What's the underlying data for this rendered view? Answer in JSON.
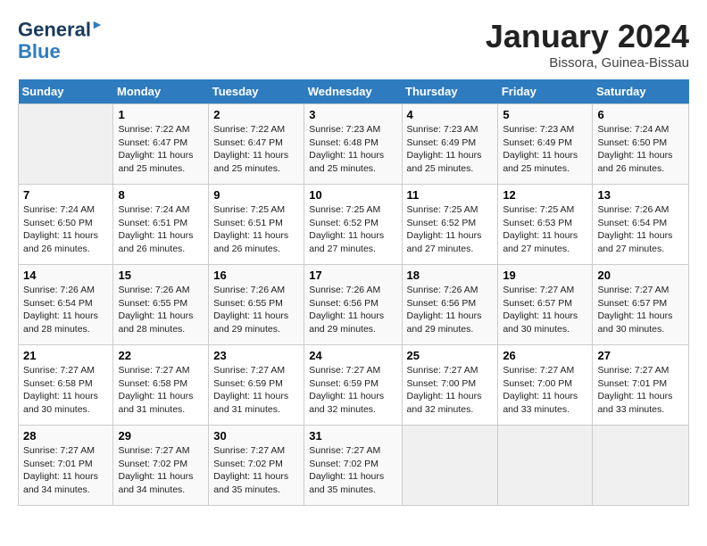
{
  "header": {
    "logo_line1": "General",
    "logo_line2": "Blue",
    "month": "January 2024",
    "location": "Bissora, Guinea-Bissau"
  },
  "weekdays": [
    "Sunday",
    "Monday",
    "Tuesday",
    "Wednesday",
    "Thursday",
    "Friday",
    "Saturday"
  ],
  "weeks": [
    [
      {
        "day": "",
        "info": ""
      },
      {
        "day": "1",
        "info": "Sunrise: 7:22 AM\nSunset: 6:47 PM\nDaylight: 11 hours\nand 25 minutes."
      },
      {
        "day": "2",
        "info": "Sunrise: 7:22 AM\nSunset: 6:47 PM\nDaylight: 11 hours\nand 25 minutes."
      },
      {
        "day": "3",
        "info": "Sunrise: 7:23 AM\nSunset: 6:48 PM\nDaylight: 11 hours\nand 25 minutes."
      },
      {
        "day": "4",
        "info": "Sunrise: 7:23 AM\nSunset: 6:49 PM\nDaylight: 11 hours\nand 25 minutes."
      },
      {
        "day": "5",
        "info": "Sunrise: 7:23 AM\nSunset: 6:49 PM\nDaylight: 11 hours\nand 25 minutes."
      },
      {
        "day": "6",
        "info": "Sunrise: 7:24 AM\nSunset: 6:50 PM\nDaylight: 11 hours\nand 26 minutes."
      }
    ],
    [
      {
        "day": "7",
        "info": "Sunrise: 7:24 AM\nSunset: 6:50 PM\nDaylight: 11 hours\nand 26 minutes."
      },
      {
        "day": "8",
        "info": "Sunrise: 7:24 AM\nSunset: 6:51 PM\nDaylight: 11 hours\nand 26 minutes."
      },
      {
        "day": "9",
        "info": "Sunrise: 7:25 AM\nSunset: 6:51 PM\nDaylight: 11 hours\nand 26 minutes."
      },
      {
        "day": "10",
        "info": "Sunrise: 7:25 AM\nSunset: 6:52 PM\nDaylight: 11 hours\nand 27 minutes."
      },
      {
        "day": "11",
        "info": "Sunrise: 7:25 AM\nSunset: 6:52 PM\nDaylight: 11 hours\nand 27 minutes."
      },
      {
        "day": "12",
        "info": "Sunrise: 7:25 AM\nSunset: 6:53 PM\nDaylight: 11 hours\nand 27 minutes."
      },
      {
        "day": "13",
        "info": "Sunrise: 7:26 AM\nSunset: 6:54 PM\nDaylight: 11 hours\nand 27 minutes."
      }
    ],
    [
      {
        "day": "14",
        "info": "Sunrise: 7:26 AM\nSunset: 6:54 PM\nDaylight: 11 hours\nand 28 minutes."
      },
      {
        "day": "15",
        "info": "Sunrise: 7:26 AM\nSunset: 6:55 PM\nDaylight: 11 hours\nand 28 minutes."
      },
      {
        "day": "16",
        "info": "Sunrise: 7:26 AM\nSunset: 6:55 PM\nDaylight: 11 hours\nand 29 minutes."
      },
      {
        "day": "17",
        "info": "Sunrise: 7:26 AM\nSunset: 6:56 PM\nDaylight: 11 hours\nand 29 minutes."
      },
      {
        "day": "18",
        "info": "Sunrise: 7:26 AM\nSunset: 6:56 PM\nDaylight: 11 hours\nand 29 minutes."
      },
      {
        "day": "19",
        "info": "Sunrise: 7:27 AM\nSunset: 6:57 PM\nDaylight: 11 hours\nand 30 minutes."
      },
      {
        "day": "20",
        "info": "Sunrise: 7:27 AM\nSunset: 6:57 PM\nDaylight: 11 hours\nand 30 minutes."
      }
    ],
    [
      {
        "day": "21",
        "info": "Sunrise: 7:27 AM\nSunset: 6:58 PM\nDaylight: 11 hours\nand 30 minutes."
      },
      {
        "day": "22",
        "info": "Sunrise: 7:27 AM\nSunset: 6:58 PM\nDaylight: 11 hours\nand 31 minutes."
      },
      {
        "day": "23",
        "info": "Sunrise: 7:27 AM\nSunset: 6:59 PM\nDaylight: 11 hours\nand 31 minutes."
      },
      {
        "day": "24",
        "info": "Sunrise: 7:27 AM\nSunset: 6:59 PM\nDaylight: 11 hours\nand 32 minutes."
      },
      {
        "day": "25",
        "info": "Sunrise: 7:27 AM\nSunset: 7:00 PM\nDaylight: 11 hours\nand 32 minutes."
      },
      {
        "day": "26",
        "info": "Sunrise: 7:27 AM\nSunset: 7:00 PM\nDaylight: 11 hours\nand 33 minutes."
      },
      {
        "day": "27",
        "info": "Sunrise: 7:27 AM\nSunset: 7:01 PM\nDaylight: 11 hours\nand 33 minutes."
      }
    ],
    [
      {
        "day": "28",
        "info": "Sunrise: 7:27 AM\nSunset: 7:01 PM\nDaylight: 11 hours\nand 34 minutes."
      },
      {
        "day": "29",
        "info": "Sunrise: 7:27 AM\nSunset: 7:02 PM\nDaylight: 11 hours\nand 34 minutes."
      },
      {
        "day": "30",
        "info": "Sunrise: 7:27 AM\nSunset: 7:02 PM\nDaylight: 11 hours\nand 35 minutes."
      },
      {
        "day": "31",
        "info": "Sunrise: 7:27 AM\nSunset: 7:02 PM\nDaylight: 11 hours\nand 35 minutes."
      },
      {
        "day": "",
        "info": ""
      },
      {
        "day": "",
        "info": ""
      },
      {
        "day": "",
        "info": ""
      }
    ]
  ]
}
